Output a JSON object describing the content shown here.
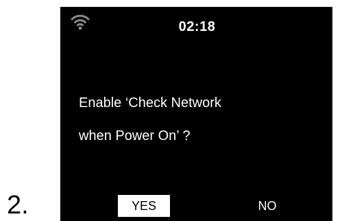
{
  "step": {
    "number": "2."
  },
  "status_bar": {
    "wifi_icon": "wifi-signal-icon",
    "time": "02:18"
  },
  "dialog": {
    "line1": "Enable ‘Check Network",
    "line2": "when Power On’ ?"
  },
  "buttons": {
    "yes_label": "YES",
    "no_label": "NO",
    "selected": "YES"
  },
  "colors": {
    "screen_background": "#000000",
    "text": "#ffffff",
    "highlight_background": "#ffffff",
    "highlight_text": "#000000"
  }
}
